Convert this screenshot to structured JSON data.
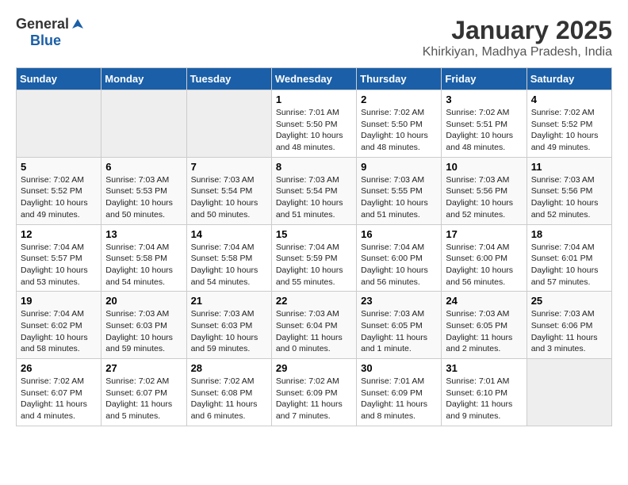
{
  "header": {
    "logo_general": "General",
    "logo_blue": "Blue",
    "title": "January 2025",
    "subtitle": "Khirkiyan, Madhya Pradesh, India"
  },
  "weekdays": [
    "Sunday",
    "Monday",
    "Tuesday",
    "Wednesday",
    "Thursday",
    "Friday",
    "Saturday"
  ],
  "weeks": [
    [
      {
        "day": "",
        "info": ""
      },
      {
        "day": "",
        "info": ""
      },
      {
        "day": "",
        "info": ""
      },
      {
        "day": "1",
        "info": "Sunrise: 7:01 AM\nSunset: 5:50 PM\nDaylight: 10 hours\nand 48 minutes."
      },
      {
        "day": "2",
        "info": "Sunrise: 7:02 AM\nSunset: 5:50 PM\nDaylight: 10 hours\nand 48 minutes."
      },
      {
        "day": "3",
        "info": "Sunrise: 7:02 AM\nSunset: 5:51 PM\nDaylight: 10 hours\nand 48 minutes."
      },
      {
        "day": "4",
        "info": "Sunrise: 7:02 AM\nSunset: 5:52 PM\nDaylight: 10 hours\nand 49 minutes."
      }
    ],
    [
      {
        "day": "5",
        "info": "Sunrise: 7:02 AM\nSunset: 5:52 PM\nDaylight: 10 hours\nand 49 minutes."
      },
      {
        "day": "6",
        "info": "Sunrise: 7:03 AM\nSunset: 5:53 PM\nDaylight: 10 hours\nand 50 minutes."
      },
      {
        "day": "7",
        "info": "Sunrise: 7:03 AM\nSunset: 5:54 PM\nDaylight: 10 hours\nand 50 minutes."
      },
      {
        "day": "8",
        "info": "Sunrise: 7:03 AM\nSunset: 5:54 PM\nDaylight: 10 hours\nand 51 minutes."
      },
      {
        "day": "9",
        "info": "Sunrise: 7:03 AM\nSunset: 5:55 PM\nDaylight: 10 hours\nand 51 minutes."
      },
      {
        "day": "10",
        "info": "Sunrise: 7:03 AM\nSunset: 5:56 PM\nDaylight: 10 hours\nand 52 minutes."
      },
      {
        "day": "11",
        "info": "Sunrise: 7:03 AM\nSunset: 5:56 PM\nDaylight: 10 hours\nand 52 minutes."
      }
    ],
    [
      {
        "day": "12",
        "info": "Sunrise: 7:04 AM\nSunset: 5:57 PM\nDaylight: 10 hours\nand 53 minutes."
      },
      {
        "day": "13",
        "info": "Sunrise: 7:04 AM\nSunset: 5:58 PM\nDaylight: 10 hours\nand 54 minutes."
      },
      {
        "day": "14",
        "info": "Sunrise: 7:04 AM\nSunset: 5:58 PM\nDaylight: 10 hours\nand 54 minutes."
      },
      {
        "day": "15",
        "info": "Sunrise: 7:04 AM\nSunset: 5:59 PM\nDaylight: 10 hours\nand 55 minutes."
      },
      {
        "day": "16",
        "info": "Sunrise: 7:04 AM\nSunset: 6:00 PM\nDaylight: 10 hours\nand 56 minutes."
      },
      {
        "day": "17",
        "info": "Sunrise: 7:04 AM\nSunset: 6:00 PM\nDaylight: 10 hours\nand 56 minutes."
      },
      {
        "day": "18",
        "info": "Sunrise: 7:04 AM\nSunset: 6:01 PM\nDaylight: 10 hours\nand 57 minutes."
      }
    ],
    [
      {
        "day": "19",
        "info": "Sunrise: 7:04 AM\nSunset: 6:02 PM\nDaylight: 10 hours\nand 58 minutes."
      },
      {
        "day": "20",
        "info": "Sunrise: 7:03 AM\nSunset: 6:03 PM\nDaylight: 10 hours\nand 59 minutes."
      },
      {
        "day": "21",
        "info": "Sunrise: 7:03 AM\nSunset: 6:03 PM\nDaylight: 10 hours\nand 59 minutes."
      },
      {
        "day": "22",
        "info": "Sunrise: 7:03 AM\nSunset: 6:04 PM\nDaylight: 11 hours\nand 0 minutes."
      },
      {
        "day": "23",
        "info": "Sunrise: 7:03 AM\nSunset: 6:05 PM\nDaylight: 11 hours\nand 1 minute."
      },
      {
        "day": "24",
        "info": "Sunrise: 7:03 AM\nSunset: 6:05 PM\nDaylight: 11 hours\nand 2 minutes."
      },
      {
        "day": "25",
        "info": "Sunrise: 7:03 AM\nSunset: 6:06 PM\nDaylight: 11 hours\nand 3 minutes."
      }
    ],
    [
      {
        "day": "26",
        "info": "Sunrise: 7:02 AM\nSunset: 6:07 PM\nDaylight: 11 hours\nand 4 minutes."
      },
      {
        "day": "27",
        "info": "Sunrise: 7:02 AM\nSunset: 6:07 PM\nDaylight: 11 hours\nand 5 minutes."
      },
      {
        "day": "28",
        "info": "Sunrise: 7:02 AM\nSunset: 6:08 PM\nDaylight: 11 hours\nand 6 minutes."
      },
      {
        "day": "29",
        "info": "Sunrise: 7:02 AM\nSunset: 6:09 PM\nDaylight: 11 hours\nand 7 minutes."
      },
      {
        "day": "30",
        "info": "Sunrise: 7:01 AM\nSunset: 6:09 PM\nDaylight: 11 hours\nand 8 minutes."
      },
      {
        "day": "31",
        "info": "Sunrise: 7:01 AM\nSunset: 6:10 PM\nDaylight: 11 hours\nand 9 minutes."
      },
      {
        "day": "",
        "info": ""
      }
    ]
  ]
}
